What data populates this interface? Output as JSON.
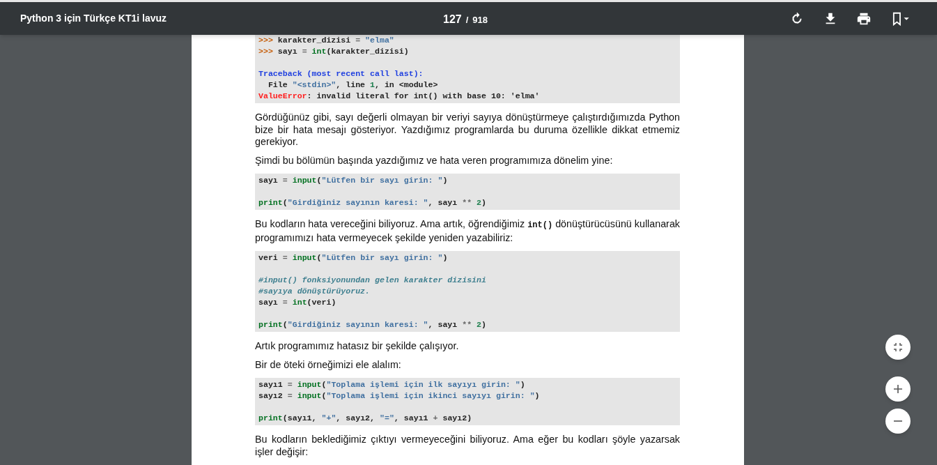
{
  "toolbar": {
    "title": "Python 3 için Türkçe KT1i lavuz",
    "page_current": "127",
    "page_separator": "/",
    "page_total": "918"
  },
  "document": {
    "blocks": [
      {
        "kind": "code",
        "lines": [
          {
            "kind": "code",
            "tokens": [
              {
                "kind": "prompt",
                "text": ">>>"
              },
              {
                "kind": "plain",
                "text": " karakter_dizisi "
              },
              {
                "kind": "operator",
                "text": "= "
              },
              {
                "kind": "string",
                "text": "\"elma\""
              }
            ]
          },
          {
            "kind": "code",
            "tokens": [
              {
                "kind": "prompt",
                "text": ">>>"
              },
              {
                "kind": "plain",
                "text": " sayı "
              },
              {
                "kind": "operator",
                "text": "= "
              },
              {
                "kind": "builtin",
                "text": "int"
              },
              {
                "kind": "plain",
                "text": "(karakter_dizisi)"
              }
            ]
          },
          {
            "kind": "blank"
          },
          {
            "kind": "code",
            "tokens": [
              {
                "kind": "traceback",
                "text": "Traceback (most recent call last):"
              }
            ]
          },
          {
            "kind": "code",
            "tokens": [
              {
                "kind": "plain",
                "text": "  File "
              },
              {
                "kind": "string",
                "text": "\"<stdin>\""
              },
              {
                "kind": "plain",
                "text": ", line "
              },
              {
                "kind": "number",
                "text": "1"
              },
              {
                "kind": "plain",
                "text": ", in <module>"
              }
            ]
          },
          {
            "kind": "code",
            "tokens": [
              {
                "kind": "error",
                "text": "ValueError"
              },
              {
                "kind": "plain",
                "text": ": invalid literal for int() with base 10: 'elma'"
              }
            ]
          }
        ]
      },
      {
        "kind": "paragraph",
        "parts": [
          {
            "kind": "text",
            "text": "Gördüğünüz gibi, sayı değerli olmayan bir veriyi sayıya dönüştürmeye çalıştırdığımızda Python bize bir hata mesajı gösteriyor. Yazdığımız programlarda bu duruma özellikle dikkat etmemiz gerekiyor."
          }
        ]
      },
      {
        "kind": "paragraph",
        "parts": [
          {
            "kind": "text",
            "text": "Şimdi bu bölümün başında yazdığımız ve hata veren programımıza dönelim yine:"
          }
        ]
      },
      {
        "kind": "code",
        "lines": [
          {
            "kind": "code",
            "tokens": [
              {
                "kind": "plain",
                "text": "sayı "
              },
              {
                "kind": "operator",
                "text": "= "
              },
              {
                "kind": "builtin",
                "text": "input"
              },
              {
                "kind": "plain",
                "text": "("
              },
              {
                "kind": "string",
                "text": "\"Lütfen bir sayı girin: \""
              },
              {
                "kind": "plain",
                "text": ")"
              }
            ]
          },
          {
            "kind": "blank"
          },
          {
            "kind": "code",
            "tokens": [
              {
                "kind": "builtin",
                "text": "print"
              },
              {
                "kind": "plain",
                "text": "("
              },
              {
                "kind": "string",
                "text": "\"Girdiğiniz sayının karesi: \""
              },
              {
                "kind": "plain",
                "text": ", sayı "
              },
              {
                "kind": "operator",
                "text": "** "
              },
              {
                "kind": "number",
                "text": "2"
              },
              {
                "kind": "plain",
                "text": ")"
              }
            ]
          }
        ]
      },
      {
        "kind": "paragraph",
        "parts": [
          {
            "kind": "text",
            "text": "Bu kodların hata vereceğini biliyoruz.  Ama artık, öğrendiğimiz "
          },
          {
            "kind": "code",
            "text": "int()"
          },
          {
            "kind": "text",
            "text": " dönüştürücüsünü kullanarak programımızı hata vermeyecek şekilde yeniden yazabiliriz:"
          }
        ]
      },
      {
        "kind": "code",
        "lines": [
          {
            "kind": "code",
            "tokens": [
              {
                "kind": "plain",
                "text": "veri "
              },
              {
                "kind": "operator",
                "text": "= "
              },
              {
                "kind": "builtin",
                "text": "input"
              },
              {
                "kind": "plain",
                "text": "("
              },
              {
                "kind": "string",
                "text": "\"Lütfen bir sayı girin: \""
              },
              {
                "kind": "plain",
                "text": ")"
              }
            ]
          },
          {
            "kind": "blank"
          },
          {
            "kind": "code",
            "tokens": [
              {
                "kind": "comment",
                "text": "#input() fonksiyonundan gelen karakter dizisini"
              }
            ]
          },
          {
            "kind": "code",
            "tokens": [
              {
                "kind": "comment",
                "text": "#sayıya dönüştürüyoruz."
              }
            ]
          },
          {
            "kind": "code",
            "tokens": [
              {
                "kind": "plain",
                "text": "sayı "
              },
              {
                "kind": "operator",
                "text": "= "
              },
              {
                "kind": "builtin",
                "text": "int"
              },
              {
                "kind": "plain",
                "text": "(veri)"
              }
            ]
          },
          {
            "kind": "blank"
          },
          {
            "kind": "code",
            "tokens": [
              {
                "kind": "builtin",
                "text": "print"
              },
              {
                "kind": "plain",
                "text": "("
              },
              {
                "kind": "string",
                "text": "\"Girdiğiniz sayının karesi: \""
              },
              {
                "kind": "plain",
                "text": ", sayı "
              },
              {
                "kind": "operator",
                "text": "** "
              },
              {
                "kind": "number",
                "text": "2"
              },
              {
                "kind": "plain",
                "text": ")"
              }
            ]
          }
        ]
      },
      {
        "kind": "paragraph",
        "parts": [
          {
            "kind": "text",
            "text": "Artık programımız hatasız bir şekilde çalışıyor."
          }
        ]
      },
      {
        "kind": "paragraph",
        "parts": [
          {
            "kind": "text",
            "text": "Bir de öteki örneğimizi ele alalım:"
          }
        ]
      },
      {
        "kind": "code",
        "lines": [
          {
            "kind": "code",
            "tokens": [
              {
                "kind": "plain",
                "text": "sayı1 "
              },
              {
                "kind": "operator",
                "text": "= "
              },
              {
                "kind": "builtin",
                "text": "input"
              },
              {
                "kind": "plain",
                "text": "("
              },
              {
                "kind": "string",
                "text": "\"Toplama işlemi için ilk sayıyı girin: \""
              },
              {
                "kind": "plain",
                "text": ")"
              }
            ]
          },
          {
            "kind": "code",
            "tokens": [
              {
                "kind": "plain",
                "text": "sayı2 "
              },
              {
                "kind": "operator",
                "text": "= "
              },
              {
                "kind": "builtin",
                "text": "input"
              },
              {
                "kind": "plain",
                "text": "("
              },
              {
                "kind": "string",
                "text": "\"Toplama işlemi için ikinci sayıyı girin: \""
              },
              {
                "kind": "plain",
                "text": ")"
              }
            ]
          },
          {
            "kind": "blank"
          },
          {
            "kind": "code",
            "tokens": [
              {
                "kind": "builtin",
                "text": "print"
              },
              {
                "kind": "plain",
                "text": "(sayı1, "
              },
              {
                "kind": "string",
                "text": "\"+\""
              },
              {
                "kind": "plain",
                "text": ", sayı2, "
              },
              {
                "kind": "string",
                "text": "\"=\""
              },
              {
                "kind": "plain",
                "text": ", sayı1 "
              },
              {
                "kind": "operator",
                "text": "+"
              },
              {
                "kind": "plain",
                "text": " sayı2)"
              }
            ]
          }
        ]
      },
      {
        "kind": "paragraph",
        "parts": [
          {
            "kind": "text",
            "text": "Bu kodların beklediğimiz çıktıyı vermeyeceğini biliyoruz. Ama eğer bu kodları şöyle yazarsak işler değişir:"
          }
        ]
      }
    ]
  }
}
